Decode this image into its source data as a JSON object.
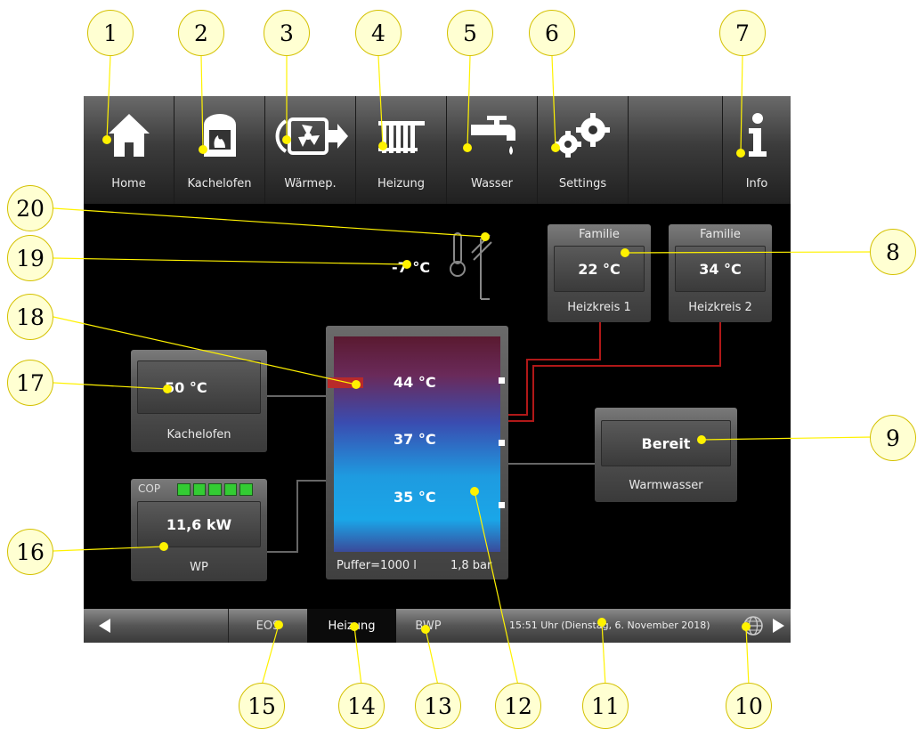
{
  "nav": {
    "home": "Home",
    "kachelofen": "Kachelofen",
    "waermepumpe": "Wärmep.",
    "heizung": "Heizung",
    "wasser": "Wasser",
    "settings": "Settings",
    "info": "Info"
  },
  "outdoor": {
    "temp": "-7 °C"
  },
  "heizkreis1": {
    "top": "Familie",
    "temp": "22 °C",
    "caption": "Heizkreis 1"
  },
  "heizkreis2": {
    "top": "Familie",
    "temp": "34 °C",
    "caption": "Heizkreis 2"
  },
  "kachelofen": {
    "temp": "50 °C",
    "caption": "Kachelofen"
  },
  "wp": {
    "cop_label": "COP",
    "cop_level": 5,
    "cop_max": 5,
    "power": "11,6 kW",
    "caption": "WP"
  },
  "puffer": {
    "t_top": "44 °C",
    "t_mid": "37 °C",
    "t_bottom": "35 °C",
    "capacity": "Puffer=1000 l",
    "pressure": "1,8 bar"
  },
  "warmwasser": {
    "status": "Bereit",
    "caption": "Warmwasser"
  },
  "bottom": {
    "tab_eos": "EOS",
    "tab_heizung": "Heizung",
    "tab_bwp": "BWP",
    "datetime": "15:51 Uhr (Dienstag, 6. November 2018)"
  },
  "callouts": [
    "1",
    "2",
    "3",
    "4",
    "5",
    "6",
    "7",
    "8",
    "9",
    "10",
    "11",
    "12",
    "13",
    "14",
    "15",
    "16",
    "17",
    "18",
    "19",
    "20"
  ],
  "colors": {
    "callout_fill": "#ffffd2",
    "callout_dot": "#fff200",
    "cop_green": "#33cc33",
    "pipe_red": "#b01818"
  }
}
